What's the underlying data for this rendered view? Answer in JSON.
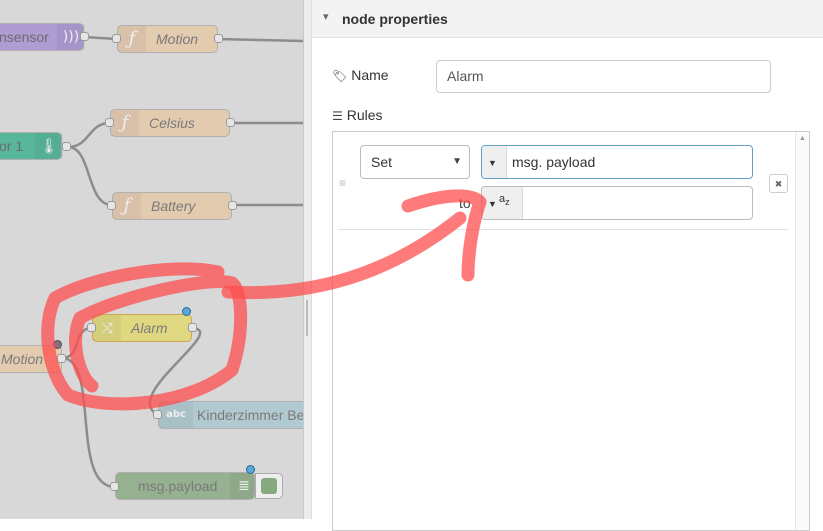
{
  "canvas": {
    "nodes": {
      "sensor": "nsensor",
      "motion_fn": "Motion",
      "temp": "or 1",
      "celsius": "Celsius",
      "battery": "Battery",
      "motion_in": "Motion",
      "alarm": "Alarm",
      "kinder": "Kinderzimmer Be",
      "kinder_icon": "abc",
      "debug": "msg.payload"
    },
    "icons": {
      "wifi": "wifi-icon",
      "function": "function-icon",
      "thermometer": "thermometer-icon",
      "shuffle": "shuffle-icon",
      "text": "text-icon",
      "list": "list-icon"
    }
  },
  "tray": {
    "title": "node properties",
    "name_label": "Name",
    "name_value": "Alarm",
    "rules_label": "Rules",
    "rule": {
      "action": "Set",
      "property": "msg. payload",
      "to_label": "to",
      "to_type_glyph": "a",
      "to_type_sub": "z",
      "to_value": ""
    },
    "remove_glyph": "✖"
  },
  "colors": {
    "canvas_bg": "#d8d8d8",
    "sensor_node": "#a58fd1",
    "function_node": "#e6c9a8",
    "temp_node": "#3cb08e",
    "change_node": "#e2d96e",
    "ui_text_node": "#a9c7d1",
    "debug_node": "#87a980",
    "annotation": "#ff4d4d"
  }
}
